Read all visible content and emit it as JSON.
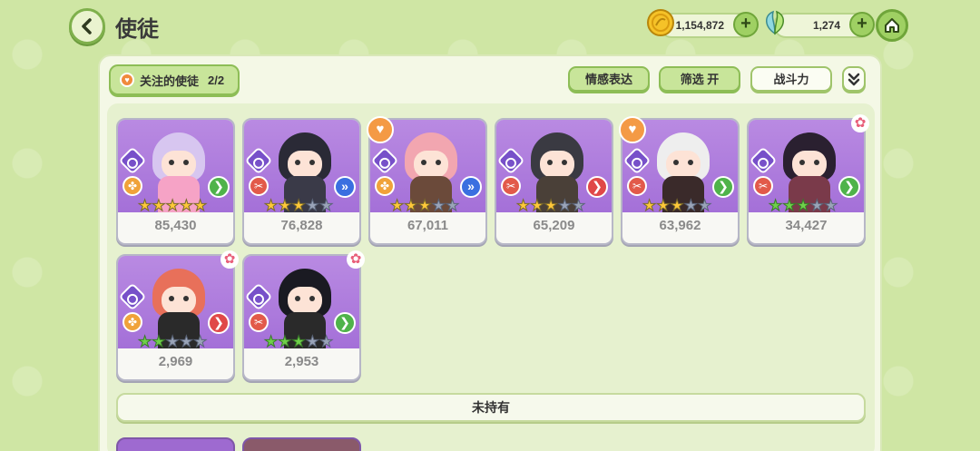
{
  "header": {
    "title": "使徒"
  },
  "currencies": [
    {
      "name": "gold",
      "value": "1,154,872",
      "icon": "gold-coin-icon",
      "plus": "+"
    },
    {
      "name": "leaf",
      "value": "1,274",
      "icon": "leaf-icon",
      "plus": "+"
    }
  ],
  "panel": {
    "follow_label": "关注的使徒",
    "follow_count": "2/2",
    "buttons": {
      "emotion": "情感表达",
      "filter": "筛选 开",
      "power": "战斗力",
      "sort": "»"
    },
    "not_owned_label": "未持有"
  },
  "characters": [
    {
      "power": "85,430",
      "stars": [
        "gold",
        "gold",
        "gold",
        "gold",
        "gold"
      ],
      "class": "orange",
      "class_icon": "✤",
      "role": "green",
      "role_icon": "❯",
      "hair": "#d7c6f0",
      "body": "#f6a3c6",
      "heart": false,
      "flower": false
    },
    {
      "power": "76,828",
      "stars": [
        "gold",
        "gold",
        "gold",
        "empty",
        "empty"
      ],
      "class": "red",
      "class_icon": "✂",
      "role": "blue",
      "role_icon": "»",
      "hair": "#2a2a36",
      "body": "#3a3a48",
      "heart": false,
      "flower": false
    },
    {
      "power": "67,011",
      "stars": [
        "gold",
        "gold",
        "gold",
        "empty",
        "empty"
      ],
      "class": "orange",
      "class_icon": "✤",
      "role": "blue",
      "role_icon": "»",
      "hair": "#f2a6b0",
      "body": "#6b4a3a",
      "heart": true,
      "flower": false
    },
    {
      "power": "65,209",
      "stars": [
        "gold",
        "gold",
        "gold",
        "empty",
        "empty"
      ],
      "class": "red",
      "class_icon": "✂",
      "role": "red",
      "role_icon": "❯",
      "hair": "#3a3a42",
      "body": "#4a4038",
      "heart": false,
      "flower": false
    },
    {
      "power": "63,962",
      "stars": [
        "gold",
        "gold",
        "gold",
        "empty",
        "empty"
      ],
      "class": "red",
      "class_icon": "✂",
      "role": "green",
      "role_icon": "❯",
      "hair": "#eeeeee",
      "body": "#3a2a2a",
      "heart": true,
      "flower": false
    },
    {
      "power": "34,427",
      "stars": [
        "green",
        "green",
        "green",
        "empty",
        "empty"
      ],
      "class": "red",
      "class_icon": "✂",
      "role": "green",
      "role_icon": "❯",
      "hair": "#2a2030",
      "body": "#7a3a4a",
      "heart": false,
      "flower": true
    },
    {
      "power": "2,969",
      "stars": [
        "green",
        "green",
        "empty",
        "empty",
        "empty"
      ],
      "class": "orange",
      "class_icon": "✤",
      "role": "red",
      "role_icon": "❯",
      "hair": "#e8705a",
      "body": "#2a2a2a",
      "heart": false,
      "flower": true
    },
    {
      "power": "2,953",
      "stars": [
        "green",
        "green",
        "green",
        "empty",
        "empty"
      ],
      "class": "red",
      "class_icon": "✂",
      "role": "green",
      "role_icon": "❯",
      "hair": "#1a1a22",
      "body": "#2a2a2a",
      "heart": false,
      "flower": true
    }
  ]
}
